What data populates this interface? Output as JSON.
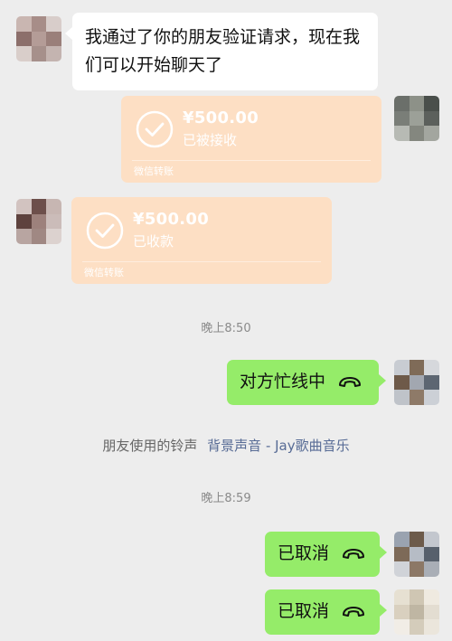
{
  "messages": {
    "friend_request": "我通过了你的朋友验证请求，现在我们可以开始聊天了"
  },
  "transfers": {
    "sent": {
      "amount": "¥500.00",
      "status": "已被接收",
      "footer": "微信转账"
    },
    "received": {
      "amount": "¥500.00",
      "status": "已收款",
      "footer": "微信转账"
    }
  },
  "timestamps": {
    "first": "晚上8:50",
    "second": "晚上8:59"
  },
  "calls": {
    "busy": "对方忙线中",
    "cancelled_1": "已取消",
    "cancelled_2": "已取消"
  },
  "ringtone": {
    "prefix": "朋友使用的铃声",
    "song": "背景声音 - Jay歌曲音乐"
  },
  "colors": {
    "background": "#ededed",
    "self_bubble": "#95ec69",
    "other_bubble": "#ffffff",
    "transfer_card": "#fddfc4",
    "link": "#576b95"
  },
  "icons": [
    "check-circle-icon",
    "phone-hangup-icon"
  ]
}
